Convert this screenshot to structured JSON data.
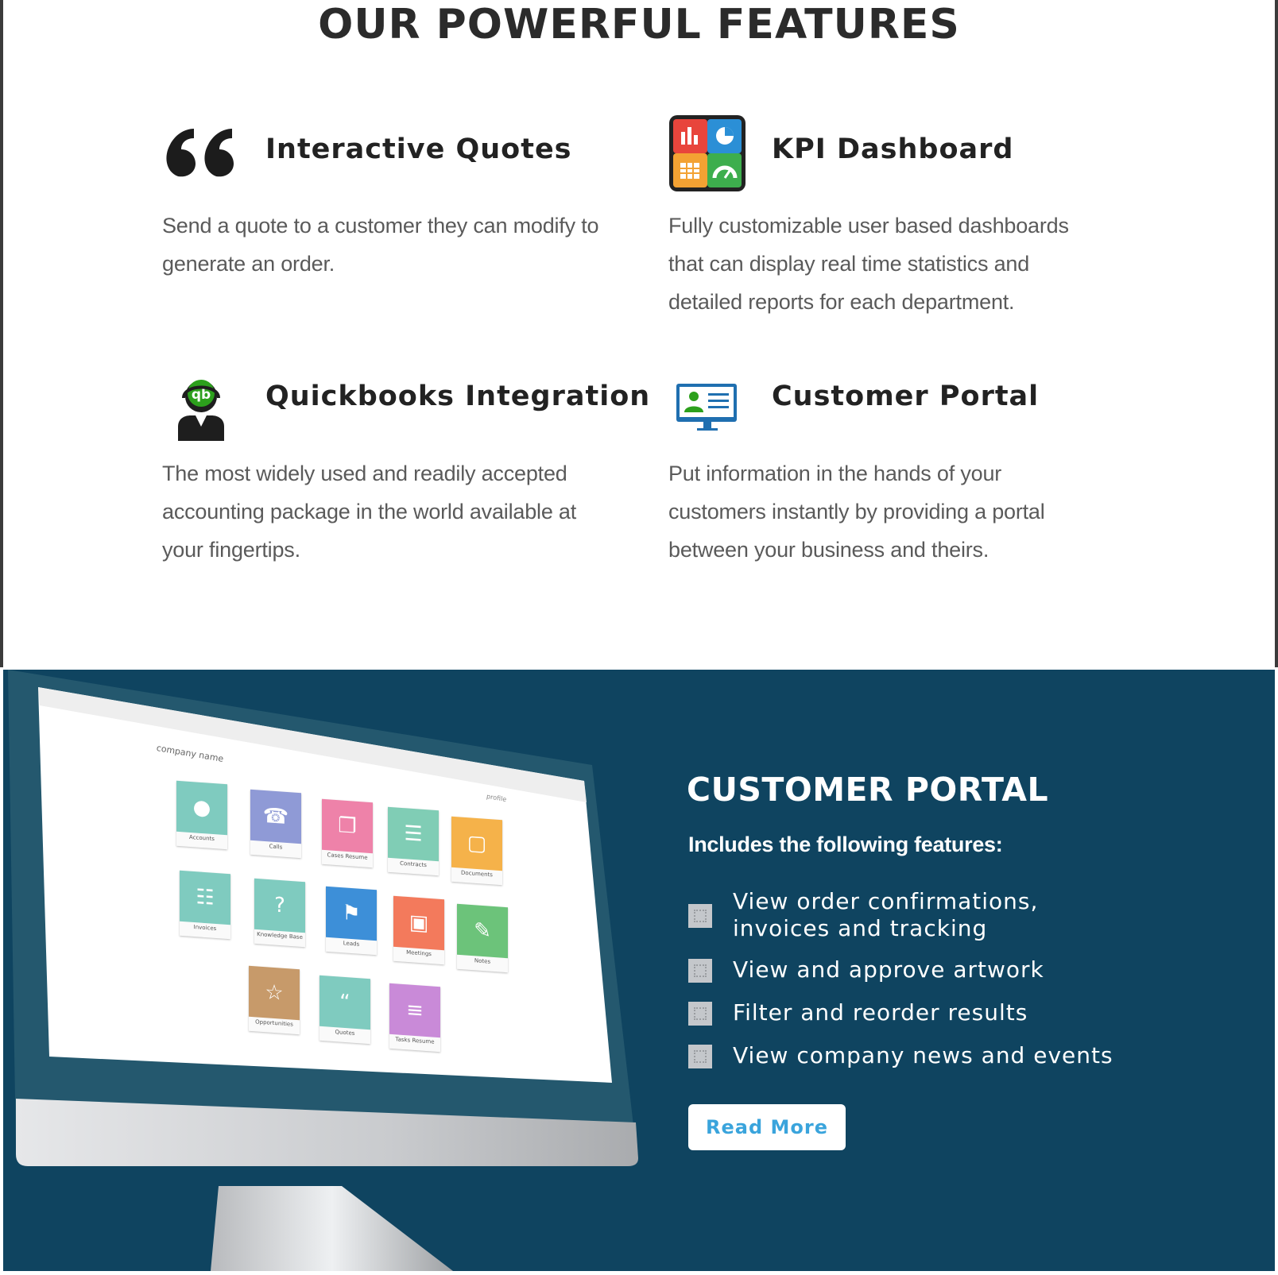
{
  "header": {
    "title": "OUR POWERFUL FEATURES"
  },
  "features": [
    {
      "title": "Interactive Quotes",
      "icon": "quote-icon",
      "description": [
        "Send a quote to a customer they can modify to",
        "generate an order."
      ]
    },
    {
      "title": "KPI Dashboard",
      "icon": "kpi-dashboard-icon",
      "description": [
        "Fully customizable user based dashboards",
        "that can display real time statistics and",
        "detailed reports for each department."
      ]
    },
    {
      "title": "Quickbooks Integration",
      "icon": "quickbooks-icon",
      "description": [
        "The most widely used and readily accepted",
        "accounting package in the world available at",
        "your fingertips."
      ]
    },
    {
      "title": "Customer Portal",
      "icon": "customer-portal-icon",
      "description": [
        "Put information in the hands of your",
        "customers instantly by providing a portal",
        "between your business and theirs."
      ]
    }
  ],
  "portal": {
    "title": "CUSTOMER PORTAL",
    "subtitle": "Includes the following features:",
    "items": [
      [
        "View order confirmations,",
        "invoices and tracking"
      ],
      [
        "View and approve artwork"
      ],
      [
        "Filter and reorder results"
      ],
      [
        "View company news and events"
      ]
    ],
    "button_label": "Read More"
  },
  "monitor_screen": {
    "company_name": "company name",
    "menu_label": "profile",
    "tiles": [
      {
        "label": "Accounts",
        "color": "#7fcbbf"
      },
      {
        "label": "Calls",
        "color": "#8f9ad6"
      },
      {
        "label": "Cases Resume",
        "color": "#ee82a9"
      },
      {
        "label": "Contracts",
        "color": "#80cdb5"
      },
      {
        "label": "Documents",
        "color": "#f5b24a"
      },
      {
        "label": "Invoices",
        "color": "#7fcbbf"
      },
      {
        "label": "Knowledge Base",
        "color": "#7fcbbf"
      },
      {
        "label": "Leads",
        "color": "#3d8fd8"
      },
      {
        "label": "Meetings",
        "color": "#f37a5c"
      },
      {
        "label": "Notes",
        "color": "#6cc37a"
      },
      {
        "label": "Opportunities",
        "color": "#c79a6a"
      },
      {
        "label": "Quotes",
        "color": "#7fcbbf"
      },
      {
        "label": "Tasks Resume",
        "color": "#c98ad8"
      }
    ]
  },
  "colors": {
    "portal_bg": "#0f4460",
    "button_text": "#3aa4dc"
  }
}
